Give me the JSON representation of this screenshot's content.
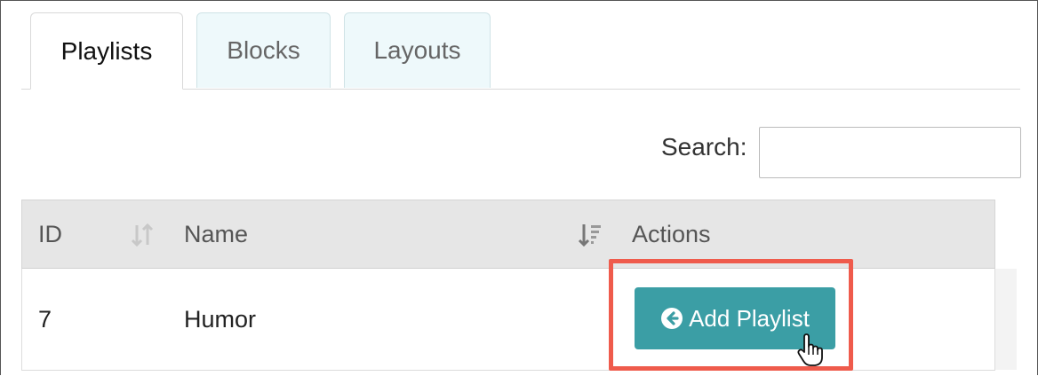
{
  "tabs": [
    {
      "label": "Playlists",
      "active": true
    },
    {
      "label": "Blocks",
      "active": false
    },
    {
      "label": "Layouts",
      "active": false
    }
  ],
  "search": {
    "label": "Search:",
    "value": "",
    "placeholder": ""
  },
  "table": {
    "columns": [
      "ID",
      "Name",
      "Actions"
    ],
    "rows": [
      {
        "id": "7",
        "name": "Humor",
        "action_label": "Add Playlist"
      }
    ]
  },
  "colors": {
    "button": "#3b9ea5",
    "highlight": "#ef5b4c",
    "tab_inactive_bg": "#eef9fb"
  },
  "icons": {
    "button_icon": "arrow-circle-left-icon",
    "cursor": "hand-pointer-cursor-icon",
    "sort_id": "sort-both-icon",
    "sort_name": "sort-alpha-down-icon"
  }
}
